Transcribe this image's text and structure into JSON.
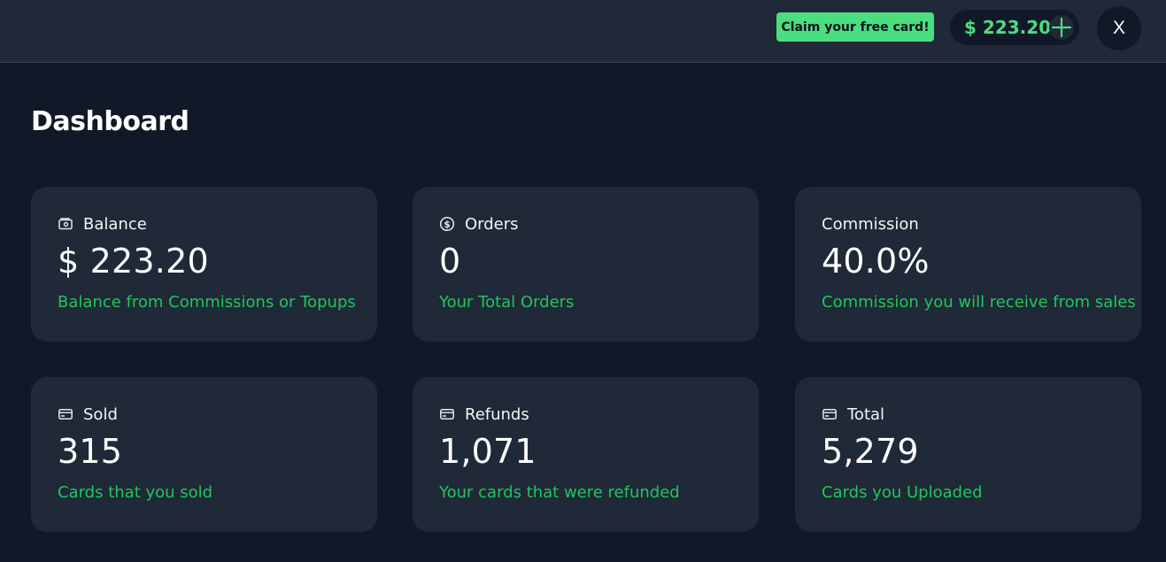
{
  "header": {
    "claim_label": "Claim your free card!",
    "balance": "$ 223.20",
    "avatar_label": "X"
  },
  "page": {
    "title": "Dashboard"
  },
  "cards": [
    {
      "icon": "wallet-icon",
      "label": "Balance",
      "value": "$ 223.20",
      "desc": "Balance from Commissions or Topups"
    },
    {
      "icon": "dollar-circle-icon",
      "label": "Orders",
      "value": "0",
      "desc": "Your Total Orders"
    },
    {
      "icon": "",
      "label": "Commission",
      "value": "40.0%",
      "desc": "Commission you will receive from sales"
    },
    {
      "icon": "credit-card-icon",
      "label": "Sold",
      "value": "315",
      "desc": "Cards that you sold"
    },
    {
      "icon": "credit-card-icon",
      "label": "Refunds",
      "value": "1,071",
      "desc": "Your cards that were refunded"
    },
    {
      "icon": "credit-card-icon",
      "label": "Total",
      "value": "5,279",
      "desc": "Cards you Uploaded"
    }
  ],
  "colors": {
    "accent": "#4ade80",
    "desc_green": "#22c55e",
    "background": "#111827",
    "card": "#1f2937"
  }
}
